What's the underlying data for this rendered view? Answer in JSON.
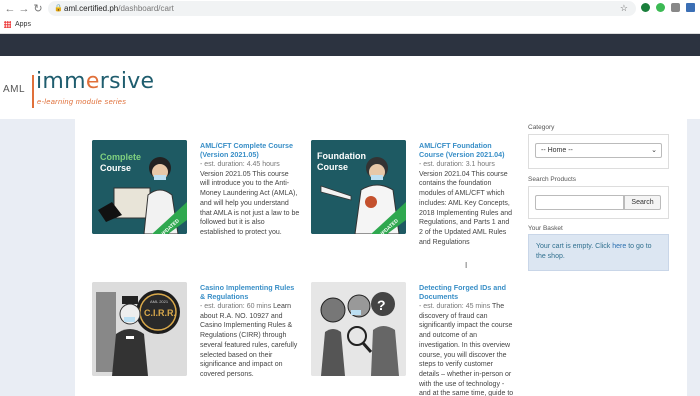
{
  "browser": {
    "url_host": "aml.certified.ph",
    "url_path": "/dashboard/cart",
    "bookmarks_label": "Apps"
  },
  "logo": {
    "prefix": "AML",
    "name_part1": "imm",
    "name_dot": "e",
    "name_part2": "rsive",
    "tagline": "e-learning module series"
  },
  "courses": [
    {
      "title": "AML/CFT Complete Course (Version 2021.05)",
      "duration": "- est. duration: 4.45 hours",
      "description": "Version 2021.05 This course will introduce you to the Anti-Money Laundering Act (AMLA), and will help you understand that AMLA is not just a law to be followed but it is also established to protect you.",
      "thumb_title": "Complete Course",
      "badge": "UPDATED"
    },
    {
      "title": "AML/CFT Foundation Course (Version 2021.04)",
      "duration": "- est. duration: 3.1 hours",
      "description": "Version 2021.04 This course contains the foundation modules of AML/CFT which includes: AML Key Concepts, 2018 Implementing Rules and Regulations, and Parts 1 and 2 of the Updated AML Rules and Regulations",
      "thumb_title": "Foundation Course",
      "badge": "UPDATED"
    },
    {
      "title": "Casino Implementing Rules & Regulations",
      "duration": "- est. duration: 60 mins",
      "description": "Learn about R.A. NO. 10927 and Casino Implementing Rules & Regulations (CIRR) through several featured rules, carefully selected based on their significance and impact on covered persons.",
      "thumb_title": "C.I.R.R.",
      "thumb_sub": "AML 2021"
    },
    {
      "title": "Detecting Forged IDs and Documents",
      "duration": "- est. duration: 45 mins",
      "description": "The discovery of fraud can significantly impact the course and outcome of an investigation. In this overview course, you will discover the steps to verify customer details – whether in-person or with the use of technology - and at the same time, guide to",
      "thumb_title": ""
    }
  ],
  "sidebar": {
    "category_label": "Category",
    "category_value": "-- Home --",
    "search_label": "Search Products",
    "search_placeholder": "",
    "search_button": "Search",
    "basket_label": "Your Basket",
    "basket_text_before": "Your cart is empty. Click ",
    "basket_link": "here",
    "basket_text_after": " to go to the shop."
  },
  "colors": {
    "topbar": "#2c3340",
    "accent_orange": "#e0703a",
    "link_blue": "#3a8fc7",
    "thumb_teal": "#1e5a63",
    "thumb_green": "#2fa84f"
  }
}
